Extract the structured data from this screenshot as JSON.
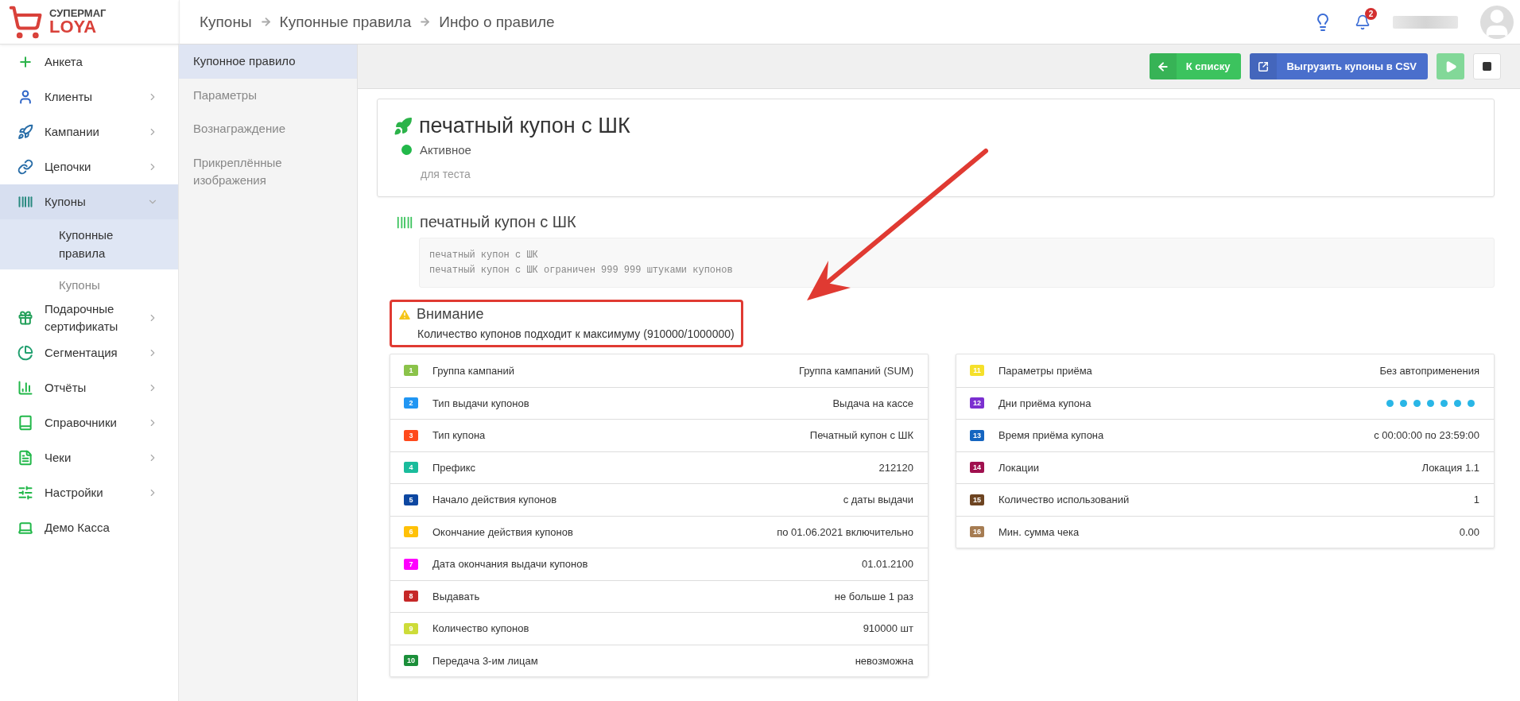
{
  "logo": {
    "top": "СУПЕРМАГ",
    "bottom": "LOYA"
  },
  "breadcrumbs": [
    "Купоны",
    "Купонные правила",
    "Инфо о правиле"
  ],
  "header": {
    "notification_count": "2"
  },
  "sidebar": {
    "items": [
      {
        "label": "Анкета",
        "expandable": false,
        "selected": false
      },
      {
        "label": "Клиенты",
        "expandable": true,
        "expanded": false,
        "selected": false
      },
      {
        "label": "Кампании",
        "expandable": true,
        "expanded": false,
        "selected": false
      },
      {
        "label": "Цепочки",
        "expandable": true,
        "expanded": false,
        "selected": false
      },
      {
        "label": "Купоны",
        "expandable": true,
        "expanded": true,
        "selected": true,
        "children": [
          {
            "label": "Купонные правила",
            "selected": true
          },
          {
            "label": "Купоны",
            "selected": false
          }
        ]
      },
      {
        "label": "Подарочные сертификаты",
        "expandable": true,
        "expanded": false,
        "selected": false
      },
      {
        "label": "Сегментация",
        "expandable": true,
        "expanded": false,
        "selected": false
      },
      {
        "label": "Отчёты",
        "expandable": true,
        "expanded": false,
        "selected": false
      },
      {
        "label": "Справочники",
        "expandable": true,
        "expanded": false,
        "selected": false
      },
      {
        "label": "Чеки",
        "expandable": true,
        "expanded": false,
        "selected": false
      },
      {
        "label": "Настройки",
        "expandable": true,
        "expanded": false,
        "selected": false
      },
      {
        "label": "Демо Касса",
        "expandable": false,
        "selected": false
      }
    ]
  },
  "subnav": [
    {
      "label": "Купонное правило",
      "selected": true
    },
    {
      "label": "Параметры",
      "selected": false
    },
    {
      "label": "Вознаграждение",
      "selected": false
    },
    {
      "label": "Прикреплённые изображения",
      "selected": false
    }
  ],
  "toolbar": [
    {
      "kind": "back",
      "label": "К списку"
    },
    {
      "kind": "export",
      "label": "Выгрузить купоны в CSV"
    },
    {
      "kind": "play",
      "disabled": true
    },
    {
      "kind": "stop"
    }
  ],
  "rule": {
    "title": "печатный купон с ШК",
    "status": {
      "label": "Активное",
      "color": "#22b84a"
    },
    "description": "для теста"
  },
  "coupon": {
    "title": "печатный купон с ШК",
    "lines": [
      "печатный купон с ШК",
      "печатный купон с ШК ограничен 999 999 штуками купонов"
    ]
  },
  "warning": {
    "title": "Внимание",
    "text": "Количество купонов подходит к максимуму (910000/1000000)"
  },
  "tables": [
    [
      {
        "num": "1",
        "color": "#8bc34a",
        "label": "Группа кампаний",
        "kind": "text",
        "value": "Группа кампаний (SUM)"
      },
      {
        "num": "2",
        "color": "#2196f3",
        "label": "Тип выдачи купонов",
        "kind": "text",
        "value": "Выдача на кассе"
      },
      {
        "num": "3",
        "color": "#ff4a1c",
        "label": "Тип купона",
        "kind": "text",
        "value": "Печатный купон с ШК"
      },
      {
        "num": "4",
        "color": "#1abc9c",
        "label": "Префикс",
        "kind": "text",
        "value": "212120"
      },
      {
        "num": "5",
        "color": "#0d47a1",
        "label": "Начало действия купонов",
        "kind": "text",
        "value": "с даты выдачи"
      },
      {
        "num": "6",
        "color": "#ffc107",
        "label": "Окончание действия купонов",
        "kind": "text",
        "value": "по 01.06.2021 включительно"
      },
      {
        "num": "7",
        "color": "#ff00ff",
        "label": "Дата окончания выдачи купонов",
        "kind": "text",
        "value": "01.01.2100"
      },
      {
        "num": "8",
        "color": "#c62828",
        "label": "Выдавать",
        "kind": "text",
        "value": "не больше 1 раз"
      },
      {
        "num": "9",
        "color": "#cddc39",
        "label": "Количество купонов",
        "kind": "text",
        "value": "910000 шт"
      },
      {
        "num": "10",
        "color": "#1b8f3a",
        "label": "Передача 3-им лицам",
        "kind": "text",
        "value": "невозможна"
      }
    ],
    [
      {
        "num": "11",
        "color": "#f5e02a",
        "label": "Параметры приёма",
        "kind": "text",
        "value": "Без автоприменения"
      },
      {
        "num": "12",
        "color": "#7b2fd0",
        "label": "Дни приёма купона",
        "kind": "days",
        "days": [
          {
            "selected": true
          },
          {
            "selected": true
          },
          {
            "selected": true
          },
          {
            "selected": true
          },
          {
            "selected": true
          },
          {
            "selected": true
          },
          {
            "selected": true
          }
        ]
      },
      {
        "num": "13",
        "color": "#1565c0",
        "label": "Время приёма купона",
        "kind": "text",
        "value": "с 00:00:00 по 23:59:00"
      },
      {
        "num": "14",
        "color": "#a0104e",
        "label": "Локации",
        "kind": "text",
        "value": "Локация 1.1"
      },
      {
        "num": "15",
        "color": "#6d4421",
        "label": "Количество использований",
        "kind": "text",
        "value": "1"
      },
      {
        "num": "16",
        "color": "#a67c52",
        "label": "Мин. сумма чека",
        "kind": "text",
        "value": "0.00"
      }
    ]
  ]
}
